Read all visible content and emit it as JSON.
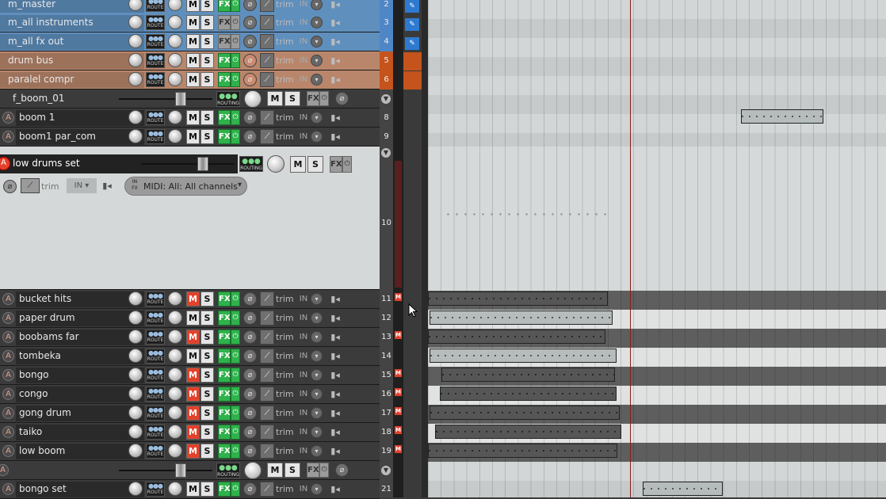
{
  "labels": {
    "route": "ROUTE",
    "routing": "ROUTING",
    "mute": "M",
    "solo": "S",
    "fx": "FX",
    "trim": "trim",
    "input": "IN",
    "midi_badge": "M"
  },
  "tracks": [
    {
      "name": "m_master",
      "number": "2"
    },
    {
      "name": "m_all instruments",
      "number": "3"
    },
    {
      "name": "m_all fx out",
      "number": "4"
    },
    {
      "name": "drum bus",
      "number": "5"
    },
    {
      "name": "paralel compr",
      "number": "6"
    },
    {
      "name": "f_boom_01",
      "number": ""
    },
    {
      "name": "boom 1",
      "number": "8"
    },
    {
      "name": "boom1 par_com",
      "number": "9"
    },
    {
      "name": "low drums set",
      "number": "10"
    },
    {
      "name": "bucket hits",
      "number": "11"
    },
    {
      "name": "paper drum",
      "number": "12"
    },
    {
      "name": "boobams far",
      "number": "13"
    },
    {
      "name": "tombeka",
      "number": "14"
    },
    {
      "name": "bongo",
      "number": "15"
    },
    {
      "name": "congo",
      "number": "16"
    },
    {
      "name": "gong drum",
      "number": "17"
    },
    {
      "name": "taiko",
      "number": "18"
    },
    {
      "name": "low boom",
      "number": "19"
    },
    {
      "name": "",
      "number": ""
    },
    {
      "name": "bongo set",
      "number": "21"
    }
  ],
  "midi_input": {
    "label": "MIDI: All: All channels",
    "in_fx": "IN FX"
  },
  "colors": {
    "blue": "#5f8fbd",
    "orange": "#b9866b",
    "mute_on": "#e3412b",
    "fx_on": "#2fb24c",
    "selected_bg": "#d5d8d8"
  }
}
